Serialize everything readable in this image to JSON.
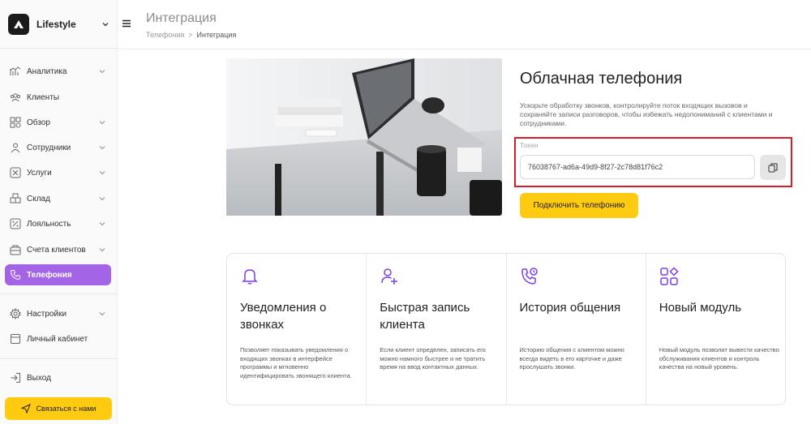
{
  "brand": {
    "name": "Lifestyle"
  },
  "nav": [
    {
      "label": "Аналитика",
      "icon": "analytics-icon"
    },
    {
      "label": "Клиенты",
      "icon": "clients-icon"
    },
    {
      "label": "Обзор",
      "icon": "overview-icon"
    },
    {
      "label": "Сотрудники",
      "icon": "employees-icon"
    },
    {
      "label": "Услуги",
      "icon": "services-icon"
    },
    {
      "label": "Склад",
      "icon": "warehouse-icon"
    },
    {
      "label": "Лояльность",
      "icon": "loyalty-icon"
    },
    {
      "label": "Счета клиентов",
      "icon": "accounts-icon"
    },
    {
      "label": "Телефония",
      "icon": "phone-icon",
      "active": true
    }
  ],
  "nav_bottom": [
    {
      "label": "Настройки",
      "icon": "settings-icon"
    },
    {
      "label": "Личный кабинет",
      "icon": "cabinet-icon"
    }
  ],
  "logout": {
    "label": "Выход"
  },
  "contact_button": {
    "label": "Связаться с нами"
  },
  "header": {
    "title": "Интеграция",
    "breadcrumb": [
      "Телефония",
      "Интеграция"
    ]
  },
  "hero": {
    "title": "Облачная телефония",
    "description": "Ускорьте обработку звонков, контролируйте поток входящих вызовов и сохраняйте записи разговоров, чтобы избежать недопониманий с клиентами и сотрудниками.",
    "token_label": "Токен",
    "token_value": "76038767-ad6a-49d9-8f27-2c78d81f76c2",
    "connect_label": "Подключить телефонию"
  },
  "features": [
    {
      "title": "Уведомления о звонках",
      "description": "Позволяет показывать уведомления о входящих звонках в интерфейсе программы и мгновенно идентифицировать звонящего клиента.",
      "icon": "bell-icon"
    },
    {
      "title": "Быстрая запись клиента",
      "description": "Если клиент определен, записать его можно намного быстрее и не тратить время на ввод контактных данных.",
      "icon": "add-user-icon"
    },
    {
      "title": "История общения",
      "description": "Историю общения с клиентом можно всегда видеть в его карточке и даже прослушать звонки.",
      "icon": "phone-history-icon"
    },
    {
      "title": "Новый модуль",
      "description": "Новый модуль позволит вывести качество обслуживания клиентов и контроль качества на новый уровень.",
      "icon": "modules-icon"
    }
  ],
  "colors": {
    "accent": "#a365e6",
    "yellow": "#ffcb10",
    "highlight": "#d71e28"
  }
}
